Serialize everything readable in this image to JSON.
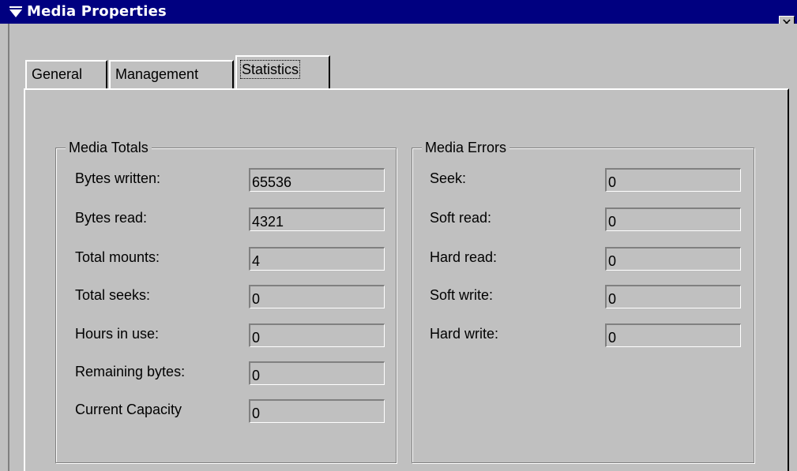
{
  "window": {
    "title": "Media Properties",
    "close_label": "✕",
    "menu_icon": "triangle-menu-icon"
  },
  "tabs": [
    {
      "label": "General",
      "selected": false
    },
    {
      "label": "Management",
      "selected": false
    },
    {
      "label": "Statistics",
      "selected": true
    }
  ],
  "media_totals": {
    "title": "Media Totals",
    "fields": [
      {
        "label": "Bytes written:",
        "value": "65536"
      },
      {
        "label": "Bytes read:",
        "value": "4321"
      },
      {
        "label": "Total mounts:",
        "value": "4"
      },
      {
        "label": "Total seeks:",
        "value": "0"
      },
      {
        "label": "Hours in use:",
        "value": "0"
      },
      {
        "label": "Remaining bytes:",
        "value": "0"
      },
      {
        "label": "Current Capacity",
        "value": "0"
      }
    ]
  },
  "media_errors": {
    "title": "Media Errors",
    "fields": [
      {
        "label": "Seek:",
        "value": "0"
      },
      {
        "label": "Soft read:",
        "value": "0"
      },
      {
        "label": "Hard read:",
        "value": "0"
      },
      {
        "label": "Soft write:",
        "value": "0"
      },
      {
        "label": "Hard write:",
        "value": "0"
      }
    ]
  },
  "colors": {
    "titlebar": "#000080",
    "face": "#c0c0c0"
  }
}
